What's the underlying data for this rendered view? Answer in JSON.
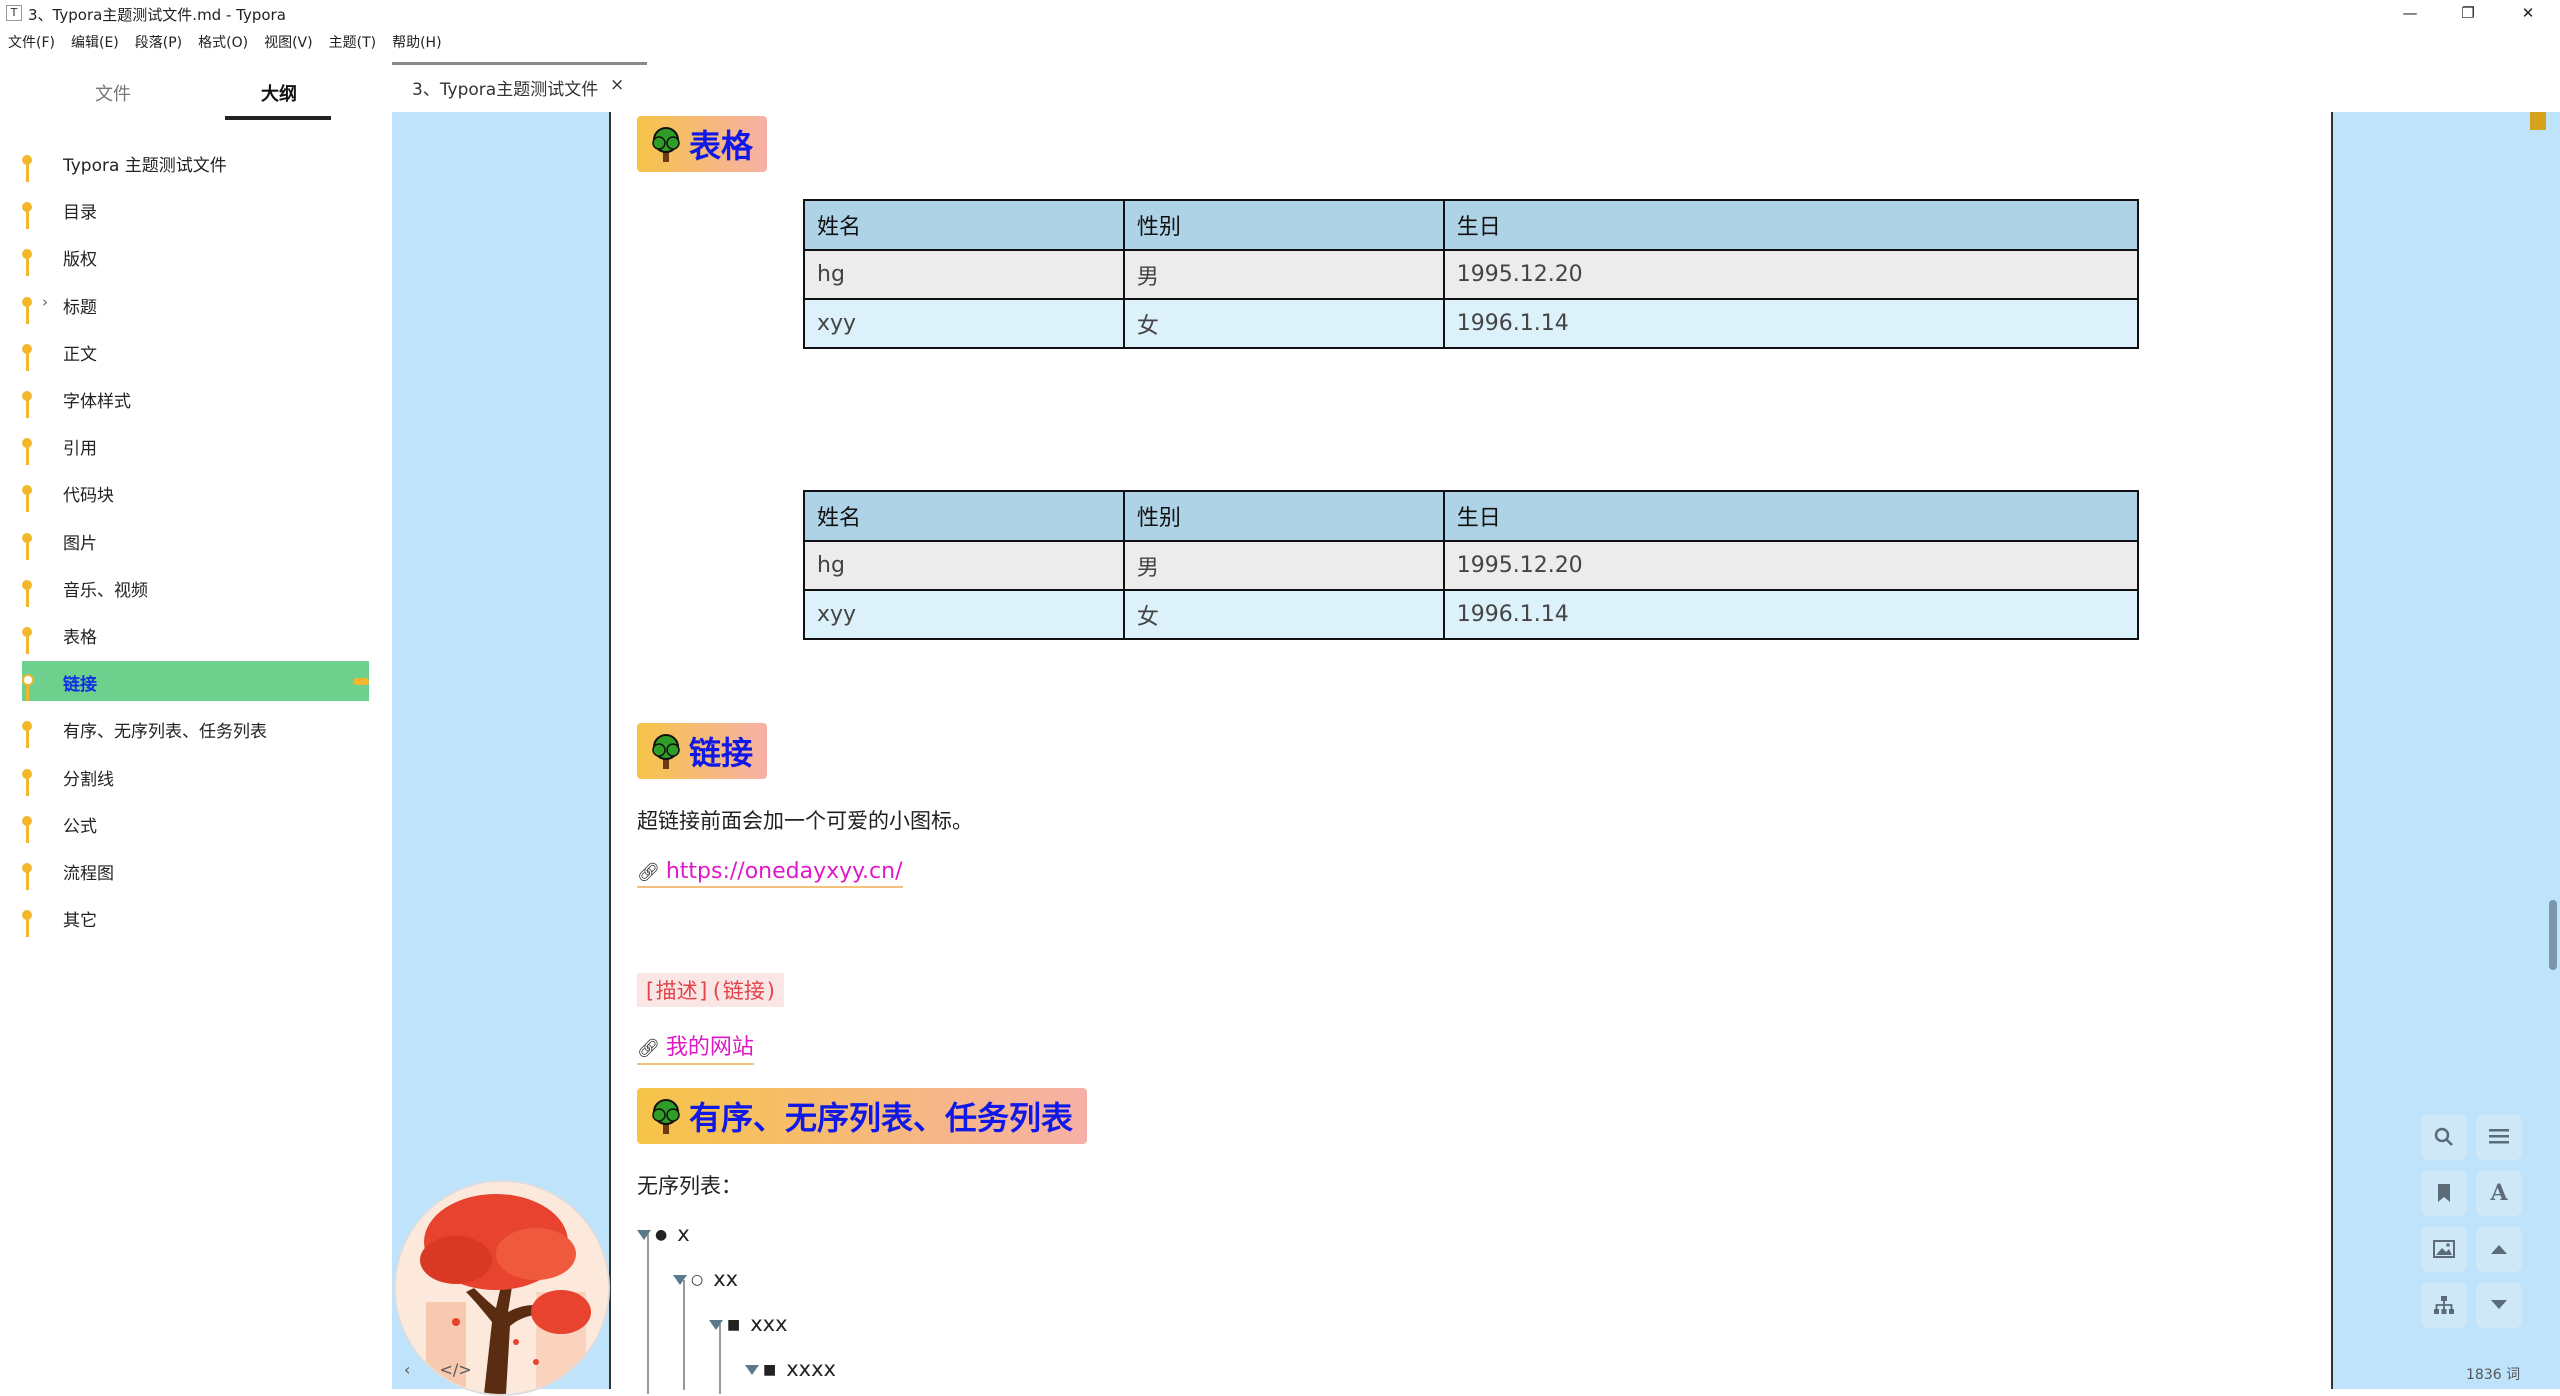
{
  "window": {
    "title": "3、Typora主题测试文件.md - Typora",
    "app_icon": "T",
    "minimize": "—",
    "restore": "❐",
    "close": "✕"
  },
  "menu": [
    "文件(F)",
    "编辑(E)",
    "段落(P)",
    "格式(O)",
    "视图(V)",
    "主题(T)",
    "帮助(H)"
  ],
  "sidebar": {
    "tabs": [
      "文件",
      "大纲"
    ],
    "active_tab": "大纲",
    "outline": [
      {
        "label": "Typora 主题测试文件"
      },
      {
        "label": "目录"
      },
      {
        "label": "版权"
      },
      {
        "label": "标题",
        "collapsed": true
      },
      {
        "label": "正文"
      },
      {
        "label": "字体样式"
      },
      {
        "label": "引用"
      },
      {
        "label": "代码块"
      },
      {
        "label": "图片"
      },
      {
        "label": "音乐、视频"
      },
      {
        "label": "表格"
      },
      {
        "label": "链接",
        "active": true
      },
      {
        "label": "有序、无序列表、任务列表"
      },
      {
        "label": "分割线"
      },
      {
        "label": "公式"
      },
      {
        "label": "流程图"
      },
      {
        "label": "其它"
      }
    ]
  },
  "tab": {
    "name": "3、Typora主题测试文件",
    "close": "×"
  },
  "doc": {
    "h_table": "表格",
    "table1": {
      "headers": [
        "姓名",
        "性别",
        "生日"
      ],
      "rows": [
        [
          "hg",
          "男",
          "1995.12.20"
        ],
        [
          "xyy",
          "女",
          "1996.1.14"
        ]
      ]
    },
    "table2": {
      "headers": [
        "姓名",
        "性别",
        "生日"
      ],
      "rows": [
        [
          "hg",
          "男",
          "1995.12.20"
        ],
        [
          "xyy",
          "女",
          "1996.1.14"
        ]
      ]
    },
    "h_link": "链接",
    "link_desc": "超链接前面会加一个可爱的小图标。",
    "url": "https://onedayxyy.cn/",
    "code_syntax": "[描述](链接)",
    "link_text": "我的网站",
    "h_lists": "有序、无序列表、任务列表",
    "unordered_label": "无序列表：",
    "list_items": [
      "x",
      "xx",
      "xxx",
      "xxxx"
    ]
  },
  "status": {
    "word_count": "1836 词"
  },
  "colors": {
    "editor_bg": "#bfe3fb",
    "heading_text": "#1018e8",
    "link": "#e018c8",
    "outline_dot": "#f3b72e",
    "active_outline": "#6dd08c"
  }
}
